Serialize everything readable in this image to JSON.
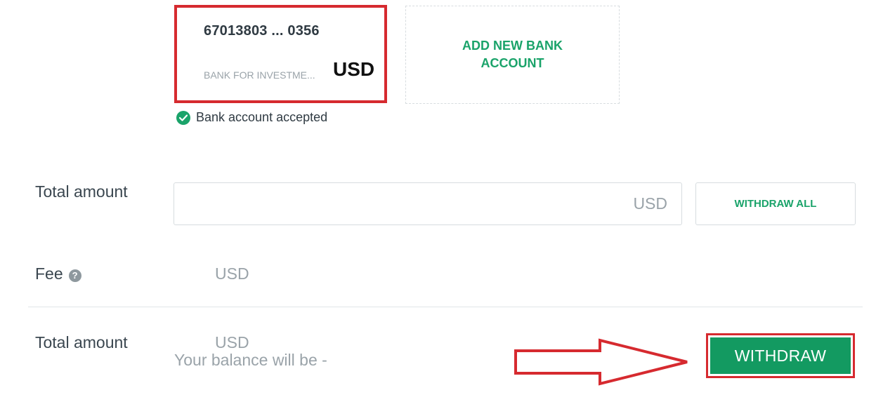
{
  "bank_card": {
    "number": "67013803 ... 0356",
    "bank_name": "BANK FOR INVESTME...",
    "currency": "USD"
  },
  "add_bank": {
    "label": "ADD NEW BANK ACCOUNT"
  },
  "status": {
    "text": "Bank account accepted",
    "icon": "check-circle-icon",
    "color": "#1aa36a"
  },
  "total_amount_input": {
    "label": "Total amount",
    "value": "",
    "placeholder": "",
    "currency": "USD"
  },
  "withdraw_all": {
    "label": "WITHDRAW ALL"
  },
  "fee": {
    "label": "Fee",
    "help_icon": "question-circle-icon",
    "help_glyph": "?",
    "value": "USD"
  },
  "summary": {
    "label": "Total amount",
    "value": "USD",
    "balance_note": "Your balance will be  -"
  },
  "withdraw": {
    "label": "WITHDRAW"
  },
  "colors": {
    "accent_green": "#1aa36a",
    "button_green": "#139a61",
    "highlight_red": "#d62a2f"
  }
}
